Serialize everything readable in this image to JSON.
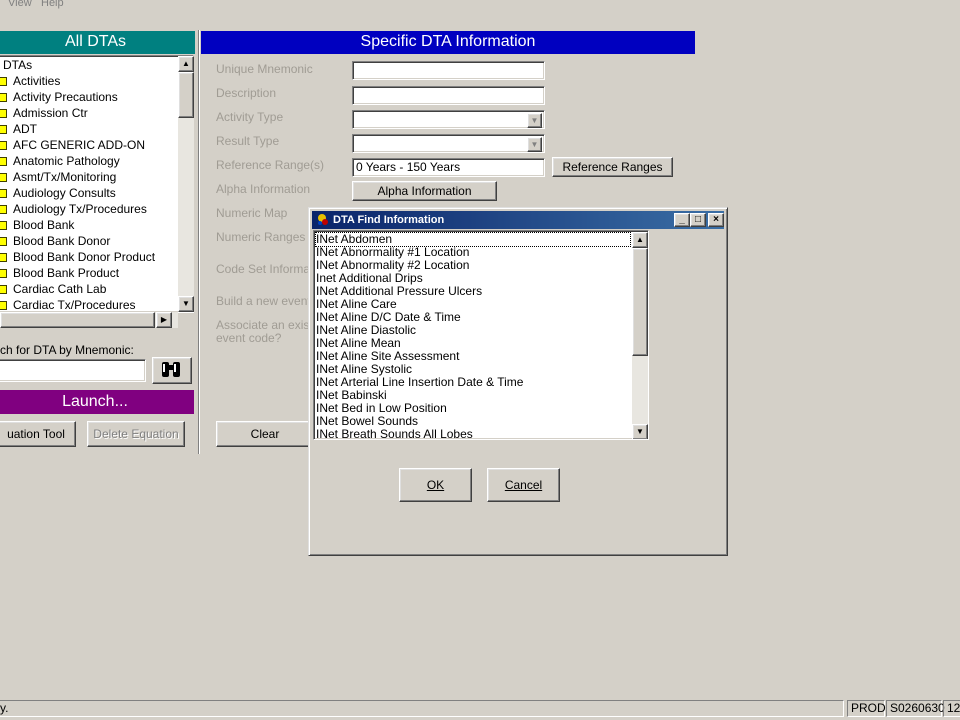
{
  "menu": {
    "view": "View",
    "help": "Help"
  },
  "left_panel": {
    "header": "All DTAs",
    "tree": [
      "l DTAs",
      "Activities",
      "Activity Precautions",
      "Admission Ctr",
      "ADT",
      "AFC GENERIC ADD-ON",
      "Anatomic Pathology",
      "Asmt/Tx/Monitoring",
      "Audiology Consults",
      "Audiology Tx/Procedures",
      "Blood Bank",
      "Blood Bank Donor",
      "Blood Bank Donor Product",
      "Blood Bank Product",
      "Cardiac Cath Lab",
      "Cardiac Tx/Procedures"
    ],
    "search_label": "ch for DTA by Mnemonic:",
    "search_value": "",
    "launch_label": "Launch...",
    "equation_tool_label": "uation Tool",
    "delete_equation_label": "Delete Equation"
  },
  "right_panel": {
    "header": "Specific DTA Information",
    "labels": {
      "unique_mnemonic": "Unique Mnemonic",
      "description": "Description",
      "activity_type": "Activity Type",
      "result_type": "Result Type",
      "reference_ranges": "Reference Range(s)",
      "alpha_information": "Alpha Information",
      "numeric_map": "Numeric Map",
      "numeric_ranges": "Numeric Ranges",
      "code_set_information": "Code Set Informatio",
      "build_event": "Build a new event c",
      "associate_line1": "Associate an existir",
      "associate_line2": "event code?"
    },
    "unique_mnemonic_value": "",
    "description_value": "",
    "activity_type_value": "",
    "result_type_value": "",
    "reference_range_value": "0 Years - 150 Years",
    "reference_ranges_button": "Reference Ranges",
    "alpha_information_button": "Alpha Information",
    "clear_button": "Clear"
  },
  "dialog": {
    "title": "DTA Find Information",
    "items": [
      "INet Abdomen",
      "INet Abnormality #1 Location",
      "INet Abnormality #2 Location",
      "Inet Additional Drips",
      "INet Additional Pressure Ulcers",
      "INet Aline Care",
      "INet Aline D/C Date & Time",
      "INet Aline Diastolic",
      "INet Aline Mean",
      "INet Aline Site Assessment",
      "INet Aline Systolic",
      "INet Arterial Line Insertion Date & Time",
      "INet Babinski",
      "INet Bed in Low Position",
      "INet Bowel Sounds",
      "INet Breath Sounds All Lobes"
    ],
    "ok_label": "OK",
    "cancel_label": "Cancel"
  },
  "status": {
    "message": "y.",
    "env": "PROD",
    "user": "S0260630",
    "time": "12:"
  }
}
